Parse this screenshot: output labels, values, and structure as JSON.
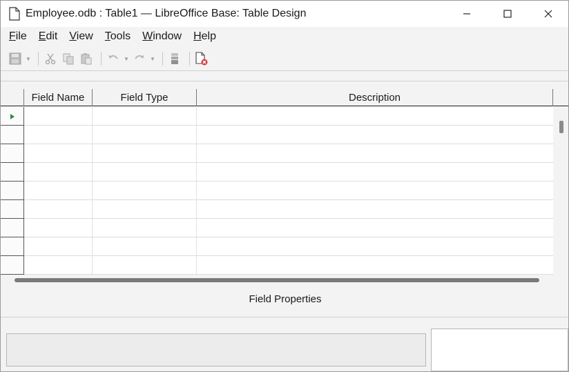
{
  "window": {
    "title": "Employee.odb : Table1 — LibreOffice Base: Table Design",
    "controls": {
      "minimize": "─",
      "maximize": "☐",
      "close": "✕"
    }
  },
  "menu": {
    "items": [
      {
        "label": "File",
        "accel": "F",
        "rest": "ile"
      },
      {
        "label": "Edit",
        "accel": "E",
        "rest": "dit"
      },
      {
        "label": "View",
        "accel": "V",
        "rest": "iew"
      },
      {
        "label": "Tools",
        "accel": "T",
        "rest": "ools"
      },
      {
        "label": "Window",
        "accel": "W",
        "rest": "indow"
      },
      {
        "label": "Help",
        "accel": "H",
        "rest": "elp"
      }
    ]
  },
  "toolbar": {
    "icons": [
      "save-icon",
      "cut-icon",
      "copy-icon",
      "paste-icon",
      "undo-icon",
      "redo-icon",
      "primary-key-icon",
      "close-document-icon"
    ],
    "disabled_color": "#a9a9a9",
    "accent_red": "#d93a3a"
  },
  "grid": {
    "columns": [
      "Field Name",
      "Field Type",
      "Description"
    ],
    "row_count": 9,
    "current_row_marker_color": "#2e8b3e"
  },
  "field_properties": {
    "label": "Field Properties"
  }
}
